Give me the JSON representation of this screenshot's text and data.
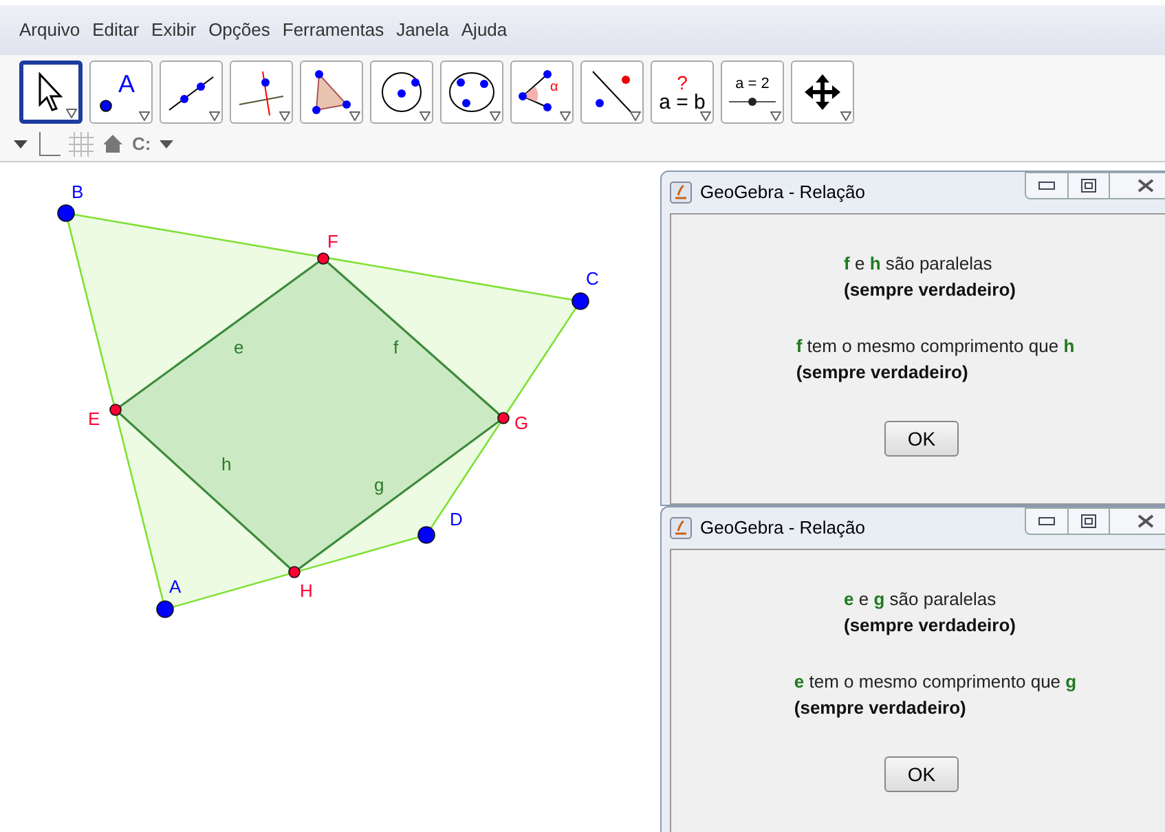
{
  "menu": [
    "Arquivo",
    "Editar",
    "Exibir",
    "Opções",
    "Ferramentas",
    "Janela",
    "Ajuda"
  ],
  "tools": [
    {
      "kind": "move",
      "selected": true
    },
    {
      "kind": "point",
      "selected": false,
      "label": "A"
    },
    {
      "kind": "line",
      "selected": false
    },
    {
      "kind": "perpendicular",
      "selected": false
    },
    {
      "kind": "polygon",
      "selected": false
    },
    {
      "kind": "circle",
      "selected": false
    },
    {
      "kind": "conic",
      "selected": false
    },
    {
      "kind": "angle",
      "selected": false,
      "label": "α"
    },
    {
      "kind": "reflect",
      "selected": false
    },
    {
      "kind": "relation",
      "selected": false,
      "top": "?",
      "label": "a = b"
    },
    {
      "kind": "slider",
      "selected": false,
      "label": "a = 2"
    },
    {
      "kind": "move_view",
      "selected": false
    }
  ],
  "style_bar": {
    "capture": "C:"
  },
  "points": [
    {
      "label": "A",
      "color": "#0000ff"
    },
    {
      "label": "B",
      "color": "#0000ff"
    },
    {
      "label": "C",
      "color": "#0000ff"
    },
    {
      "label": "D",
      "color": "#0000ff"
    },
    {
      "label": "E",
      "color": "#ff0033"
    },
    {
      "label": "F",
      "color": "#ff0033"
    },
    {
      "label": "G",
      "color": "#ff0033"
    },
    {
      "label": "H",
      "color": "#ff0033"
    }
  ],
  "segments": [
    "e",
    "f",
    "g",
    "h"
  ],
  "dialogs": [
    {
      "title": "GeoGebra - Relação",
      "statements": [
        {
          "parts": [
            {
              "kind": "object",
              "text": "f"
            },
            {
              "kind": "text",
              "text": " e "
            },
            {
              "kind": "object",
              "text": "h"
            },
            {
              "kind": "text",
              "text": " são paralelas"
            }
          ],
          "verdict": "(sempre verdadeiro)"
        },
        {
          "parts": [
            {
              "kind": "object",
              "text": "f"
            },
            {
              "kind": "text",
              "text": " tem o mesmo comprimento que "
            },
            {
              "kind": "object",
              "text": "h"
            }
          ],
          "verdict": "(sempre verdadeiro)"
        }
      ],
      "button": "OK"
    },
    {
      "title": "GeoGebra - Relação",
      "statements": [
        {
          "parts": [
            {
              "kind": "object",
              "text": "e"
            },
            {
              "kind": "text",
              "text": " e "
            },
            {
              "kind": "object",
              "text": "g"
            },
            {
              "kind": "text",
              "text": " são paralelas"
            }
          ],
          "verdict": "(sempre verdadeiro)"
        },
        {
          "parts": [
            {
              "kind": "object",
              "text": "e"
            },
            {
              "kind": "text",
              "text": " tem o mesmo comprimento que "
            },
            {
              "kind": "object",
              "text": "g"
            }
          ],
          "verdict": "(sempre verdadeiro)"
        }
      ],
      "button": "OK"
    }
  ]
}
